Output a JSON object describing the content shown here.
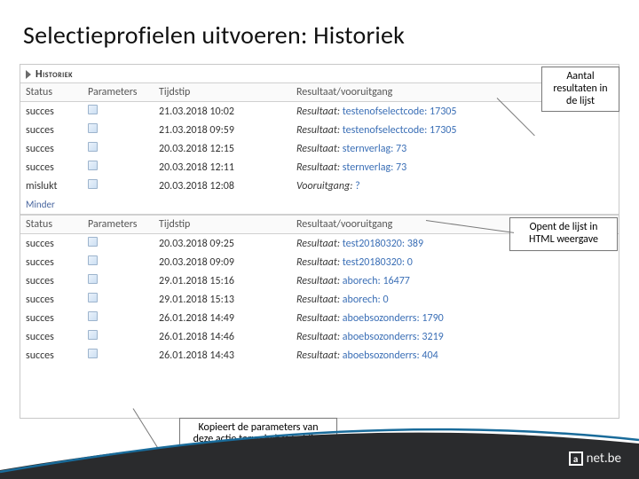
{
  "title": "Selectieprofielen uitvoeren: Historiek",
  "historiek_label": "Historiek",
  "columns": {
    "status": "Status",
    "parameters": "Parameters",
    "tijdstip": "Tijdstip",
    "result": "Resultaat/vooruitgang"
  },
  "result_prefix": "Resultaat:",
  "progress_prefix": "Vooruitgang:",
  "minder": "Minder",
  "rows_top": [
    {
      "status": "succes",
      "tijdstip": "21.03.2018 10:02",
      "kind": "result",
      "link": "testenofselectcode: 17305"
    },
    {
      "status": "succes",
      "tijdstip": "21.03.2018 09:59",
      "kind": "result",
      "link": "testenofselectcode: 17305"
    },
    {
      "status": "succes",
      "tijdstip": "20.03.2018 12:15",
      "kind": "result",
      "link": "sternverlag: 73"
    },
    {
      "status": "succes",
      "tijdstip": "20.03.2018 12:11",
      "kind": "result",
      "link": "sternverlag: 73"
    },
    {
      "status": "mislukt",
      "tijdstip": "20.03.2018 12:08",
      "kind": "progress",
      "link": "?"
    }
  ],
  "rows_bottom": [
    {
      "status": "succes",
      "tijdstip": "20.03.2018 09:25",
      "kind": "result",
      "link": "test20180320: 389"
    },
    {
      "status": "succes",
      "tijdstip": "20.03.2018 09:09",
      "kind": "result",
      "link": "test20180320: 0"
    },
    {
      "status": "succes",
      "tijdstip": "29.01.2018 15:16",
      "kind": "result",
      "link": "aborech: 16477"
    },
    {
      "status": "succes",
      "tijdstip": "29.01.2018 15:13",
      "kind": "result",
      "link": "aborech: 0"
    },
    {
      "status": "succes",
      "tijdstip": "26.01.2018 14:49",
      "kind": "result",
      "link": "aboebsozonderrs: 1790"
    },
    {
      "status": "succes",
      "tijdstip": "26.01.2018 14:46",
      "kind": "result",
      "link": "aboebsozonderrs: 3219"
    },
    {
      "status": "succes",
      "tijdstip": "26.01.2018 14:43",
      "kind": "result",
      "link": "aboebsozonderrs: 404"
    }
  ],
  "callouts": {
    "top": "Aantal resultaten in de lijst",
    "mid": "Opent de lijst in HTML weergave",
    "bot": "Kopieert de parameters van deze actie terug in het huidige scherm"
  },
  "brand": {
    "a": "a",
    "rest": "net.be"
  }
}
